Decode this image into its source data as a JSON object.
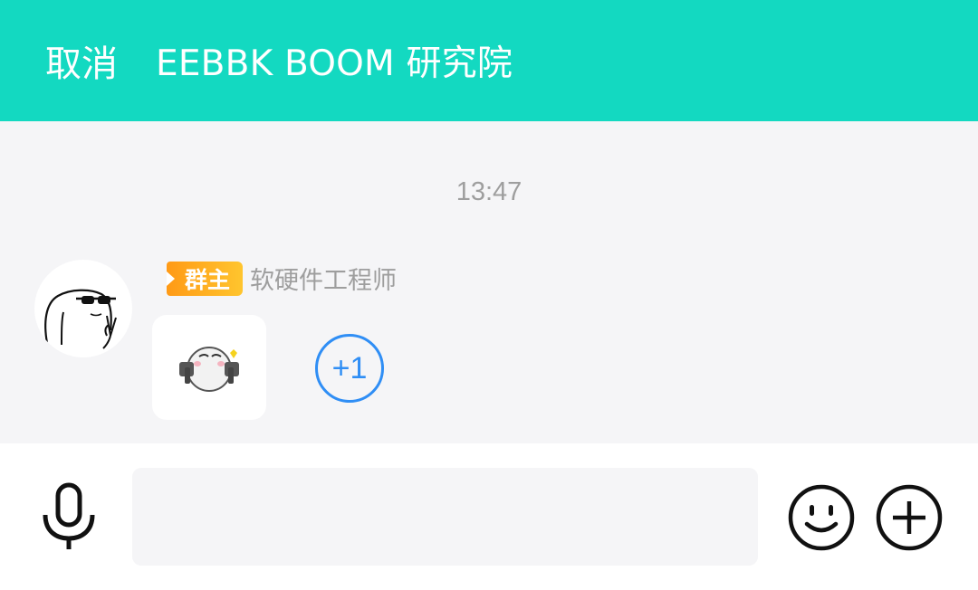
{
  "header": {
    "cancel_label": "取消",
    "title": "EEBBK BOOM 研究院",
    "background_color": "#13d9c1"
  },
  "chat": {
    "timestamp": "13:47",
    "message": {
      "sender_badge": "群主",
      "sender_name": "软硬件工程师",
      "avatar_icon": "sunglasses-character-avatar",
      "sticker_icon": "pistol-bean-sticker"
    },
    "plus_one_label": "+1",
    "plus_one_color": "#2f8ef5"
  },
  "input_bar": {
    "voice_icon": "microphone-icon",
    "text_value": "",
    "emoji_icon": "smiley-icon",
    "more_icon": "plus-circle-icon"
  }
}
